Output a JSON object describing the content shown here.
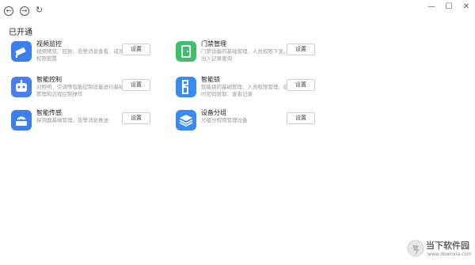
{
  "titlebar": {
    "back_glyph": "←",
    "forward_glyph": "→",
    "refresh_glyph": "↻",
    "minimize_glyph": "—",
    "maximize_glyph": "☐",
    "close_glyph": "✕"
  },
  "section": {
    "title": "已开通"
  },
  "services": [
    {
      "name": "视频监控",
      "desc": "视频预览、回放、告警消息查看、成员权限配置",
      "button": "设置",
      "icon": "camera-icon",
      "color": "#3d7ff0"
    },
    {
      "name": "门禁管理",
      "desc": "门禁设备的基础管理、人员权限下发、出入记录查询",
      "button": "设置",
      "icon": "door-icon",
      "color": "#3fbf6a"
    },
    {
      "name": "智能控制",
      "desc": "对照明、空调等智能控制设备进行基础管理和远程控制操作",
      "button": "设置",
      "icon": "robot-icon",
      "color": "#4a7ef0"
    },
    {
      "name": "智能锁",
      "desc": "智能锁的基础管理、人员权限管理、临时密码获取、查看记录",
      "button": "设置",
      "icon": "lock-icon",
      "color": "#3a8bf0"
    },
    {
      "name": "智能传感",
      "desc": "探测器基础管理，告警消息推送",
      "button": "设置",
      "icon": "sensor-icon",
      "color": "#3d7ff0"
    },
    {
      "name": "设备分组",
      "desc": "分组分权限管理设备",
      "button": "设置",
      "icon": "layers-icon",
      "color": "#3a8bf0"
    }
  ],
  "watermark": {
    "text": "当下软件园",
    "url": "www.downxia.com"
  }
}
